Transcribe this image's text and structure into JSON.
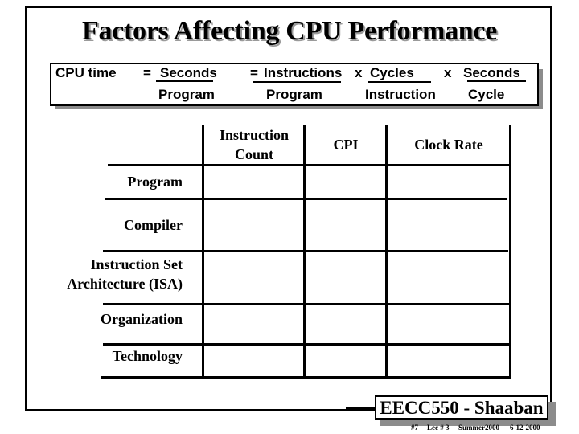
{
  "slide": {
    "title": "Factors Affecting CPU Performance",
    "formula": {
      "lhs": "CPU time",
      "eq1": "=",
      "term1_num": "Seconds",
      "term1_den": "Program",
      "eq2": "=",
      "term2_num": "Instructions",
      "term2_den": "Program",
      "times1": "x",
      "term3_num": "Cycles",
      "term3_den": "Instruction",
      "times2": "x",
      "term4_num": "Seconds",
      "term4_den": "Cycle"
    },
    "table": {
      "columns": [
        "Instruction Count",
        "CPI",
        "Clock Rate"
      ],
      "column_lines": [
        [
          "Instruction",
          "Count"
        ],
        [
          "CPI"
        ],
        [
          "Clock Rate"
        ]
      ],
      "rows": [
        {
          "label": "Program",
          "label_lines": [
            "Program"
          ],
          "cells": [
            "",
            "",
            ""
          ]
        },
        {
          "label": "Compiler",
          "label_lines": [
            "Compiler"
          ],
          "cells": [
            "",
            "",
            ""
          ]
        },
        {
          "label": "Instruction Set Architecture (ISA)",
          "label_lines": [
            "Instruction Set",
            "Architecture (ISA)"
          ],
          "cells": [
            "",
            "",
            ""
          ]
        },
        {
          "label": "Organization",
          "label_lines": [
            "Organization"
          ],
          "cells": [
            "",
            "",
            ""
          ]
        },
        {
          "label": "Technology",
          "label_lines": [
            "Technology"
          ],
          "cells": [
            "",
            "",
            ""
          ]
        }
      ]
    },
    "footer": {
      "badge": "EECC550 - Shaaban",
      "slide_number": "#7",
      "lecture": "Lec # 3",
      "term": "Summer2000",
      "date": "6-12-2000"
    }
  }
}
